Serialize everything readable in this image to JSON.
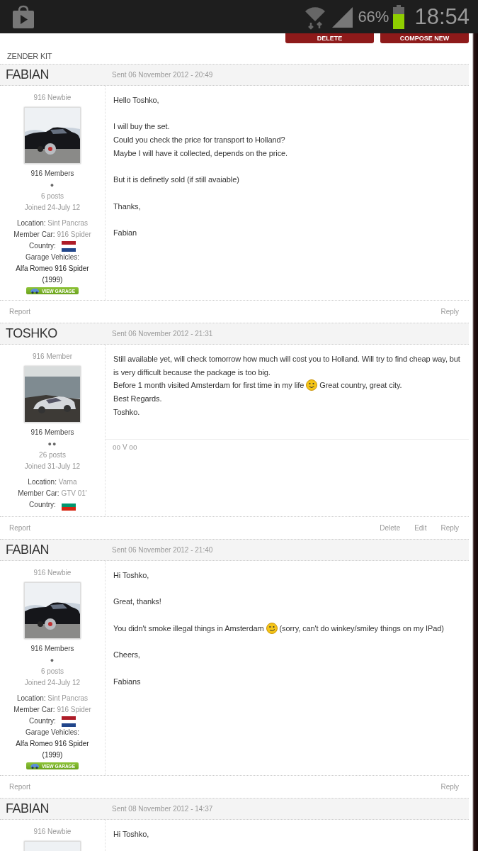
{
  "status_bar": {
    "battery": "66%",
    "time": "18:54"
  },
  "toolbar": {
    "buttons": [
      "DELETE",
      "COMPOSE NEW"
    ]
  },
  "topic": "ZENDER KIT",
  "posts": [
    {
      "author": "FABIAN",
      "sent": "Sent 06 November 2012 - 20:49",
      "rank": "916 Newbie",
      "group": "916 Members",
      "pips": "●",
      "posts": "6 posts",
      "joined": "Joined 24-July 12",
      "fields": [
        {
          "label": "Location:",
          "value": "Sint Pancras"
        },
        {
          "label": "Member Car:",
          "value": "916 Spider"
        }
      ],
      "country": {
        "label": "Country:",
        "kind": "nl"
      },
      "garage": {
        "label": "Garage Vehicles:",
        "vehicle": "Alfa Romeo 916 Spider (1999)",
        "button": "VIEW GARAGE"
      },
      "body": [
        [
          {
            "text": "Hello Toshko,"
          }
        ],
        [
          {
            "text": "I will buy the set."
          },
          {
            "text": "Could you check the price for transport to Holland?"
          },
          {
            "text": "Maybe I will have it collected, depends on the price."
          }
        ],
        [
          {
            "text": "But it is definetly sold (if still avaiable)"
          }
        ],
        [
          {
            "text": "Thanks,"
          }
        ],
        [
          {
            "text": "Fabian"
          }
        ]
      ],
      "actions_left": [
        "Report"
      ],
      "actions_right": [
        "Reply"
      ]
    },
    {
      "author": "TOSHKO",
      "sent": "Sent 06 November 2012 - 21:31",
      "rank": "916 Member",
      "group": "916 Members",
      "pips": "●●",
      "posts": "26 posts",
      "joined": "Joined 31-July 12",
      "fields": [
        {
          "label": "Location:",
          "value": "Varna"
        },
        {
          "label": "Member Car:",
          "value": "GTV 01'"
        }
      ],
      "country": {
        "label": "Country:",
        "kind": "bg"
      },
      "body": [
        [
          {
            "text": "Still available yet, will check tomorrow how much will cost you to Holland. Will try to find cheap way, but is very difficult because the package is too big."
          },
          {
            "text": "Before 1 month visited Amsterdam for first time in my life",
            "kind": "smile",
            "after": "Great country, great city."
          },
          {
            "text": "Best Regards."
          },
          {
            "text": "Toshko."
          }
        ]
      ],
      "signature": "oo V oo",
      "actions_left": [
        "Report"
      ],
      "actions_right": [
        "Delete",
        "Edit",
        "Reply"
      ]
    },
    {
      "author": "FABIAN",
      "sent": "Sent 06 November 2012 - 21:40",
      "rank": "916 Newbie",
      "group": "916 Members",
      "pips": "●",
      "posts": "6 posts",
      "joined": "Joined 24-July 12",
      "fields": [
        {
          "label": "Location:",
          "value": "Sint Pancras"
        },
        {
          "label": "Member Car:",
          "value": "916 Spider"
        }
      ],
      "country": {
        "label": "Country:",
        "kind": "nl"
      },
      "garage": {
        "label": "Garage Vehicles:",
        "vehicle": "Alfa Romeo 916 Spider (1999)",
        "button": "VIEW GARAGE"
      },
      "body": [
        [
          {
            "text": "Hi Toshko,"
          }
        ],
        [
          {
            "text": "Great, thanks!"
          }
        ],
        [
          {
            "text": "You didn't smoke illegal things in Amsterdam",
            "kind": "wink",
            "after": "(sorry, can't do winkey/smiley things on my IPad)"
          }
        ],
        [
          {
            "text": "Cheers,"
          }
        ],
        [
          {
            "text": "Fabians"
          }
        ]
      ],
      "actions_left": [
        "Report"
      ],
      "actions_right": [
        "Reply"
      ]
    },
    {
      "author": "FABIAN",
      "sent": "Sent 08 November 2012 - 14:37",
      "rank": "916 Newbie",
      "body": [
        [
          {
            "text": "Hi Toshko,"
          }
        ]
      ]
    }
  ]
}
